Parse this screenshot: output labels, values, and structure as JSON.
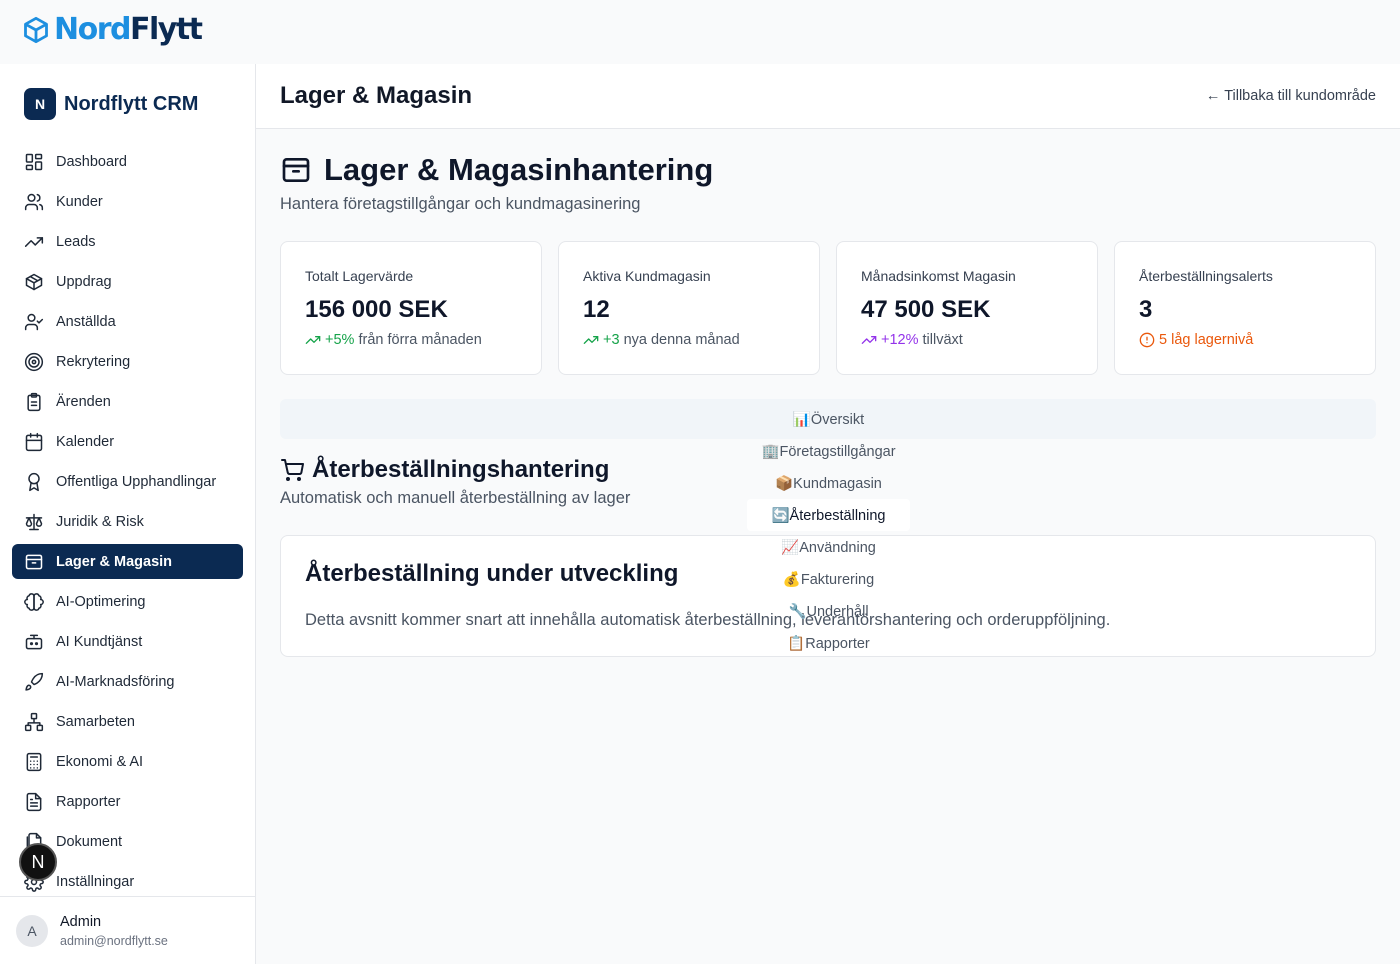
{
  "logo": {
    "part1": "Nord",
    "part2": "Flytt"
  },
  "brand": {
    "badge": "N",
    "name": "Nordflytt CRM"
  },
  "nav": [
    {
      "label": "Dashboard",
      "icon": "layout-grid-icon"
    },
    {
      "label": "Kunder",
      "icon": "users-icon"
    },
    {
      "label": "Leads",
      "icon": "trending-up-icon"
    },
    {
      "label": "Uppdrag",
      "icon": "package-icon"
    },
    {
      "label": "Anställda",
      "icon": "user-check-icon"
    },
    {
      "label": "Rekrytering",
      "icon": "target-icon"
    },
    {
      "label": "Ärenden",
      "icon": "clipboard-icon"
    },
    {
      "label": "Kalender",
      "icon": "calendar-icon"
    },
    {
      "label": "Offentliga Upphandlingar",
      "icon": "award-icon"
    },
    {
      "label": "Juridik & Risk",
      "icon": "scale-icon"
    },
    {
      "label": "Lager & Magasin",
      "icon": "archive-icon",
      "active": true
    },
    {
      "label": "AI-Optimering",
      "icon": "brain-icon"
    },
    {
      "label": "AI Kundtjänst",
      "icon": "bot-icon"
    },
    {
      "label": "AI-Marknadsföring",
      "icon": "rocket-icon"
    },
    {
      "label": "Samarbeten",
      "icon": "network-icon"
    },
    {
      "label": "Ekonomi & AI",
      "icon": "calculator-icon"
    },
    {
      "label": "Rapporter",
      "icon": "file-text-icon"
    },
    {
      "label": "Dokument",
      "icon": "files-icon"
    },
    {
      "label": "Inställningar",
      "icon": "settings-icon"
    }
  ],
  "user": {
    "initial": "A",
    "name": "Admin",
    "email": "admin@nordflytt.se"
  },
  "dev_badge": "N",
  "header": {
    "title": "Lager & Magasin",
    "back_link": "Tillbaka till kundområde",
    "back_arrow": "←"
  },
  "page": {
    "title": "Lager & Magasinhantering",
    "subtitle": "Hantera företagstillgångar och kundmagasinering"
  },
  "stats": [
    {
      "label": "Totalt Lagervärde",
      "value": "156 000 SEK",
      "note_highlight": "+5%",
      "note_rest": " från förra månaden",
      "tone": "green"
    },
    {
      "label": "Aktiva Kundmagasin",
      "value": "12",
      "note_highlight": "+3",
      "note_rest": " nya denna månad",
      "tone": "green"
    },
    {
      "label": "Månadsinkomst Magasin",
      "value": "47 500 SEK",
      "note_highlight": "+12%",
      "note_rest": " tillväxt",
      "tone": "purple"
    },
    {
      "label": "Återbeställningsalerts",
      "value": "3",
      "note_highlight": "5 låg lagernivå",
      "note_rest": "",
      "tone": "orange"
    }
  ],
  "tabs": [
    {
      "label": "📊Översikt"
    },
    {
      "label": "🏢Företagstillgångar"
    },
    {
      "label": "📦Kundmagasin"
    },
    {
      "label": "🔄Återbeställning",
      "active": true
    },
    {
      "label": "📈Användning"
    },
    {
      "label": "💰Fakturering"
    },
    {
      "label": "🔧Underhåll"
    },
    {
      "label": "📋Rapporter"
    }
  ],
  "section": {
    "title": "Återbeställningshantering",
    "subtitle": "Automatisk och manuell återbeställning av lager"
  },
  "card": {
    "title": "Återbeställning under utveckling",
    "text": "Detta avsnitt kommer snart att innehålla automatisk återbeställning, leverantörshantering och orderuppföljning."
  },
  "colors": {
    "brand_navy": "#0b2a52",
    "brand_blue": "#1d8fe0",
    "green": "#16a34a",
    "purple": "#9333ea",
    "orange": "#ea580c"
  }
}
